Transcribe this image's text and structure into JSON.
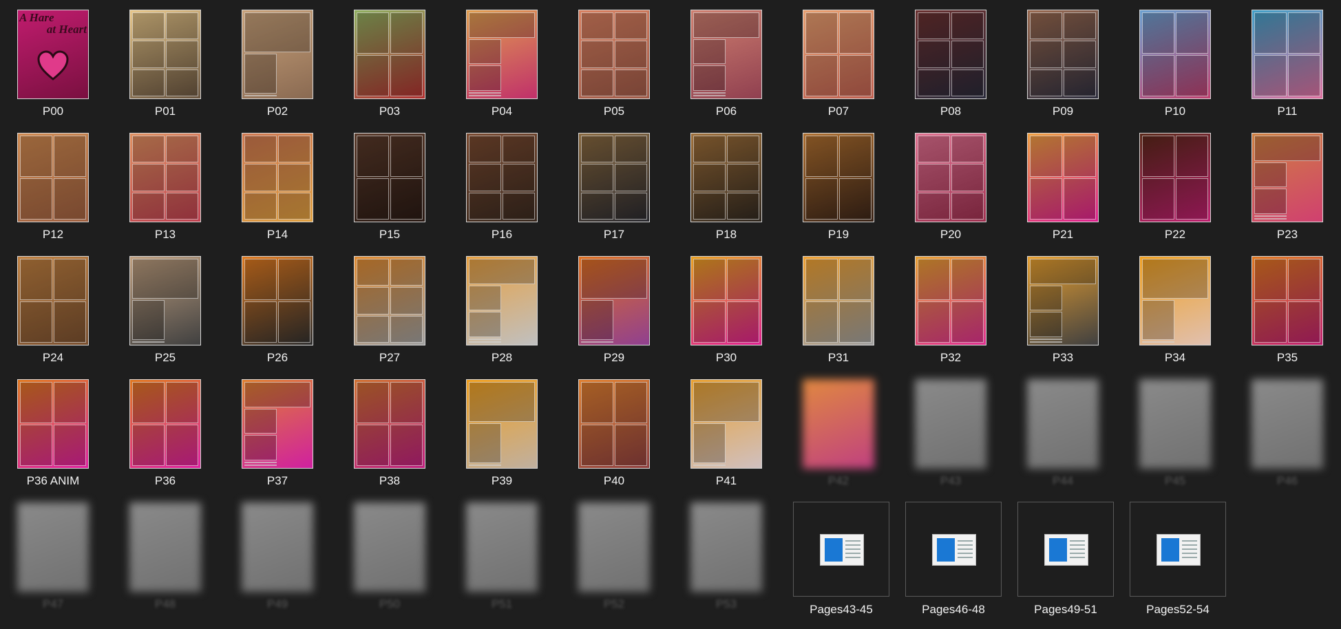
{
  "cover": {
    "title_line1": "A Hare",
    "title_line2": "at Heart"
  },
  "tiles": [
    {
      "label": "P00",
      "colors": [
        "#c01c6e",
        "#7a1040"
      ],
      "layout": "cover"
    },
    {
      "label": "P01",
      "colors": [
        "#e8c78a",
        "#6a5540"
      ],
      "layout": "g6"
    },
    {
      "label": "P02",
      "colors": [
        "#c9a27a",
        "#8a6a52"
      ],
      "layout": "g3"
    },
    {
      "label": "P03",
      "colors": [
        "#8fb060",
        "#b03030"
      ],
      "layout": "g4"
    },
    {
      "label": "P04",
      "colors": [
        "#e2a050",
        "#c0306a"
      ],
      "layout": "g5"
    },
    {
      "label": "P05",
      "colors": [
        "#d98060",
        "#a05a48"
      ],
      "layout": "g6"
    },
    {
      "label": "P06",
      "colors": [
        "#d08070",
        "#904050"
      ],
      "layout": "g5"
    },
    {
      "label": "P07",
      "colors": [
        "#e9a070",
        "#c06050"
      ],
      "layout": "g4"
    },
    {
      "label": "P08",
      "colors": [
        "#6a3030",
        "#2a2a3a"
      ],
      "layout": "g6"
    },
    {
      "label": "P09",
      "colors": [
        "#9a6a50",
        "#303040"
      ],
      "layout": "g6"
    },
    {
      "label": "P10",
      "colors": [
        "#6aa0d0",
        "#c04070"
      ],
      "layout": "g4"
    },
    {
      "label": "P11",
      "colors": [
        "#40a0c8",
        "#e070a0"
      ],
      "layout": "g4"
    },
    {
      "label": "P12",
      "colors": [
        "#d08a50",
        "#a06040"
      ],
      "layout": "g4"
    },
    {
      "label": "P13",
      "colors": [
        "#e09060",
        "#c04050"
      ],
      "layout": "g6"
    },
    {
      "label": "P14",
      "colors": [
        "#d07850",
        "#e0a040"
      ],
      "layout": "g6"
    },
    {
      "label": "P15",
      "colors": [
        "#5a3a2a",
        "#2a1a14"
      ],
      "layout": "g4"
    },
    {
      "label": "P16",
      "colors": [
        "#7a4a30",
        "#3a2a20"
      ],
      "layout": "g6"
    },
    {
      "label": "P17",
      "colors": [
        "#8a6a40",
        "#2a2a30"
      ],
      "layout": "g6"
    },
    {
      "label": "P18",
      "colors": [
        "#a0703a",
        "#302820"
      ],
      "layout": "g6"
    },
    {
      "label": "P19",
      "colors": [
        "#b07030",
        "#3a2418"
      ],
      "layout": "g4"
    },
    {
      "label": "P20",
      "colors": [
        "#e07090",
        "#a03050"
      ],
      "layout": "g6"
    },
    {
      "label": "P21",
      "colors": [
        "#f0a040",
        "#e02090"
      ],
      "layout": "g4"
    },
    {
      "label": "P22",
      "colors": [
        "#5a2818",
        "#c02070"
      ],
      "layout": "g4"
    },
    {
      "label": "P23",
      "colors": [
        "#d08040",
        "#d04070"
      ],
      "layout": "g5"
    },
    {
      "label": "P24",
      "colors": [
        "#c08040",
        "#7a5030"
      ],
      "layout": "g4"
    },
    {
      "label": "P25",
      "colors": [
        "#c0a080",
        "#404040"
      ],
      "layout": "g3"
    },
    {
      "label": "P26",
      "colors": [
        "#e07a20",
        "#303030"
      ],
      "layout": "g4"
    },
    {
      "label": "P27",
      "colors": [
        "#e08a30",
        "#a0a0a0"
      ],
      "layout": "g6"
    },
    {
      "label": "P28",
      "colors": [
        "#e8a040",
        "#c0c0c0"
      ],
      "layout": "g5"
    },
    {
      "label": "P29",
      "colors": [
        "#e07020",
        "#904090"
      ],
      "layout": "g3"
    },
    {
      "label": "P30",
      "colors": [
        "#e8a020",
        "#e02090"
      ],
      "layout": "g4"
    },
    {
      "label": "P31",
      "colors": [
        "#f0a030",
        "#a0a0a0"
      ],
      "layout": "g4"
    },
    {
      "label": "P32",
      "colors": [
        "#e8a030",
        "#e03090"
      ],
      "layout": "g4"
    },
    {
      "label": "P33",
      "colors": [
        "#e8a030",
        "#404040"
      ],
      "layout": "g5"
    },
    {
      "label": "P34",
      "colors": [
        "#f0a020",
        "#e0c0b0"
      ],
      "layout": "g3"
    },
    {
      "label": "P35",
      "colors": [
        "#e07820",
        "#c02070"
      ],
      "layout": "g4"
    },
    {
      "label": "P36 ANIM",
      "colors": [
        "#e07820",
        "#e020a0"
      ],
      "layout": "g4"
    },
    {
      "label": "P36",
      "colors": [
        "#e07820",
        "#e020a0"
      ],
      "layout": "g4"
    },
    {
      "label": "P37",
      "colors": [
        "#e08030",
        "#d020a0"
      ],
      "layout": "g5"
    },
    {
      "label": "P38",
      "colors": [
        "#d07030",
        "#c02080"
      ],
      "layout": "g4"
    },
    {
      "label": "P39",
      "colors": [
        "#f0a020",
        "#c0b0a0"
      ],
      "layout": "g3"
    },
    {
      "label": "P40",
      "colors": [
        "#e08030",
        "#904040"
      ],
      "layout": "g4"
    },
    {
      "label": "P41",
      "colors": [
        "#e8a030",
        "#d0c0c0"
      ],
      "layout": "g3"
    },
    {
      "label": "P42",
      "colors": [
        "#e08840",
        "#c04080"
      ],
      "layout": "blur"
    },
    {
      "label": "P43",
      "colors": [
        "#8a8a8a",
        "#707070"
      ],
      "layout": "blur"
    },
    {
      "label": "P44",
      "colors": [
        "#8a8a8a",
        "#707070"
      ],
      "layout": "blur"
    },
    {
      "label": "P45",
      "colors": [
        "#8a8a8a",
        "#707070"
      ],
      "layout": "blur"
    },
    {
      "label": "P46",
      "colors": [
        "#8a8a8a",
        "#707070"
      ],
      "layout": "blur"
    },
    {
      "label": "P47",
      "colors": [
        "#8a8a8a",
        "#707070"
      ],
      "layout": "blur"
    },
    {
      "label": "P48",
      "colors": [
        "#8a8a8a",
        "#707070"
      ],
      "layout": "blur"
    },
    {
      "label": "P49",
      "colors": [
        "#8a8a8a",
        "#707070"
      ],
      "layout": "blur"
    },
    {
      "label": "P50",
      "colors": [
        "#8a8a8a",
        "#707070"
      ],
      "layout": "blur"
    },
    {
      "label": "P51",
      "colors": [
        "#8a8a8a",
        "#707070"
      ],
      "layout": "blur"
    },
    {
      "label": "P52",
      "colors": [
        "#8a8a8a",
        "#707070"
      ],
      "layout": "blur"
    },
    {
      "label": "P53",
      "colors": [
        "#8a8a8a",
        "#707070"
      ],
      "layout": "blur"
    }
  ],
  "folders": [
    {
      "label": "Pages43-45"
    },
    {
      "label": "Pages46-48"
    },
    {
      "label": "Pages49-51"
    },
    {
      "label": "Pages52-54"
    }
  ]
}
